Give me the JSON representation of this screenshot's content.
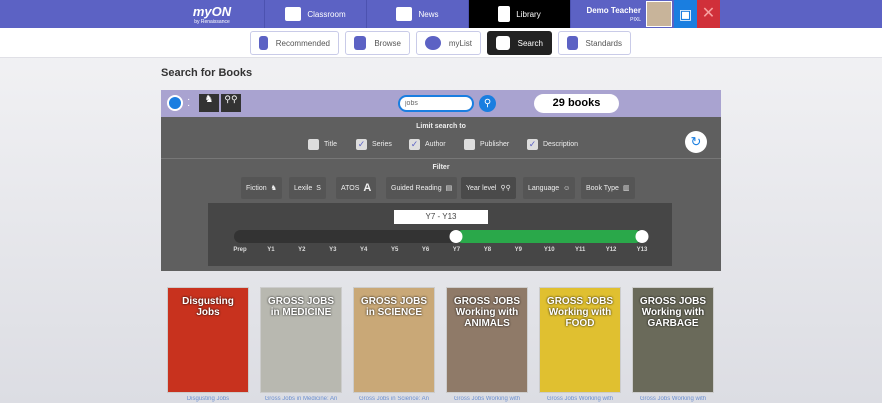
{
  "nav": {
    "logo": "myON",
    "logo_sub": "by Renaissance",
    "tabs": [
      {
        "label": "Classroom"
      },
      {
        "label": "News"
      },
      {
        "label": "Library",
        "active": true
      }
    ],
    "user": "Demo Teacher",
    "user_sub": "PIXL"
  },
  "subnav": [
    {
      "label": "Recommended",
      "icon": "thumbs-up-icon"
    },
    {
      "label": "Browse",
      "icon": "binoculars-icon"
    },
    {
      "label": "myList",
      "icon": "heart-icon"
    },
    {
      "label": "Search",
      "icon": "search-book-icon",
      "active": true
    },
    {
      "label": "Standards",
      "icon": "standards-icon"
    }
  ],
  "page_title": "Search for Books",
  "search": {
    "value": "jobs",
    "count": "29 books"
  },
  "limit": {
    "label": "Limit search to",
    "options": [
      {
        "label": "Title",
        "checked": false
      },
      {
        "label": "Series",
        "checked": true
      },
      {
        "label": "Author",
        "checked": true
      },
      {
        "label": "Publisher",
        "checked": false
      },
      {
        "label": "Description",
        "checked": true
      }
    ]
  },
  "filter": {
    "label": "Filter",
    "items": [
      "Fiction",
      "Lexile",
      "ATOS",
      "Guided Reading",
      "Year level",
      "Language",
      "Book Type"
    ],
    "active": "Year level"
  },
  "slider": {
    "range_label": "Y7 - Y13",
    "ticks": [
      "Prep",
      "Y1",
      "Y2",
      "Y3",
      "Y4",
      "Y5",
      "Y6",
      "Y7",
      "Y8",
      "Y9",
      "Y10",
      "Y11",
      "Y12",
      "Y13"
    ],
    "min": "Y7",
    "max": "Y13",
    "fill_color": "#2aa84a"
  },
  "books": [
    {
      "cover_title": "Disgusting Jobs",
      "label": "Disgusting Jobs",
      "color": "#c8321e"
    },
    {
      "cover_title": "GROSS JOBS in MEDICINE",
      "label": "Gross Jobs in Medicine: An",
      "color": "#b8b8b0"
    },
    {
      "cover_title": "GROSS JOBS in SCIENCE",
      "label": "Gross Jobs in Science: An",
      "color": "#c9a877"
    },
    {
      "cover_title": "GROSS JOBS Working with ANIMALS",
      "label": "Gross Jobs Working with",
      "color": "#8f7a68"
    },
    {
      "cover_title": "GROSS JOBS Working with FOOD",
      "label": "Gross Jobs Working with",
      "color": "#e0c030"
    },
    {
      "cover_title": "GROSS JOBS Working with GARBAGE",
      "label": "Gross Jobs Working with",
      "color": "#6a6a5a"
    }
  ]
}
